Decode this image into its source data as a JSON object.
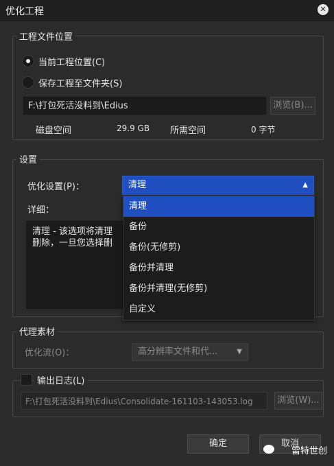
{
  "window": {
    "title": "优化工程",
    "close_glyph": "✕"
  },
  "location_group": {
    "legend": "工程文件位置",
    "radio_current": "当前工程位置(C)",
    "radio_save_folder": "保存工程至文件夹(S)",
    "path_value": "F:\\打包死活没料到\\Edius",
    "browse_label": "浏览(B)...",
    "disk_space_label": "磁盘空间",
    "disk_space_value": "29.9 GB",
    "required_space_label": "所需空间",
    "required_space_value": "0 字节"
  },
  "settings_group": {
    "legend": "设置",
    "optimize_label": "优化设置(P)：",
    "optimize_value": "清理",
    "detail_label": "详细：",
    "detail_line1": "清理 - 该选项将清理",
    "detail_line2": "删除，一旦您选择删",
    "dropdown_options": [
      "清理",
      "备份",
      "备份(无修剪)",
      "备份并清理",
      "备份并清理(无修剪)",
      "自定义"
    ],
    "selected_index": 0
  },
  "proxy_group": {
    "legend": "代理素材",
    "stream_label": "优化流(O)：",
    "stream_value": "高分辨率文件和代..."
  },
  "log_group": {
    "legend": "输出日志(L)",
    "path_value": "F:\\打包死活没料到\\Edius\\Consolidate-161103-143053.log",
    "browse_label": "浏览(W)..."
  },
  "footer": {
    "ok_label": "确定",
    "cancel_label": "取消",
    "watermark": "雷特世创"
  }
}
